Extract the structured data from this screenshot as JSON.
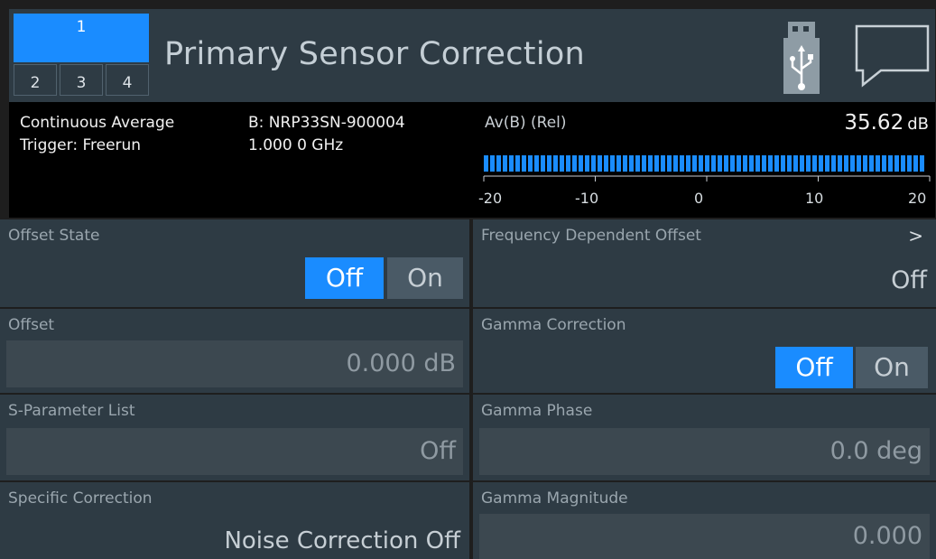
{
  "header": {
    "active_tab": "1",
    "tabs": [
      "2",
      "3",
      "4"
    ],
    "title": "Primary Sensor Correction",
    "usb_icon": "usb-icon",
    "message_icon": "message-icon"
  },
  "status": {
    "mode": "Continuous Average",
    "trigger": "Trigger: Freerun",
    "sensor": "B: NRP33SN-900004",
    "frequency": "1.000 0 GHz",
    "reading_label": "Av(B) (Rel)",
    "reading_value": "35.62",
    "reading_unit": "dB",
    "bar_range": [
      -20,
      20
    ],
    "bar_level": 35.62,
    "tick_labels": [
      "-20",
      "-10",
      "0",
      "10",
      "20"
    ],
    "accent": "#1a8cff"
  },
  "params": {
    "offset_state": {
      "label": "Offset State",
      "off": "Off",
      "on": "On",
      "selected": "Off"
    },
    "freq_dep_offset": {
      "label": "Frequency Dependent Offset",
      "value": "Off",
      "chevron": ">"
    },
    "offset": {
      "label": "Offset",
      "value": "0.000  dB"
    },
    "gamma_correction": {
      "label": "Gamma Correction",
      "off": "Off",
      "on": "On",
      "selected": "Off"
    },
    "s_param_list": {
      "label": "S-Parameter List",
      "value": "Off"
    },
    "gamma_phase": {
      "label": "Gamma Phase",
      "value": "0.0  deg"
    },
    "specific_correction": {
      "label": "Specific Correction",
      "value": "Noise Correction Off"
    },
    "gamma_magnitude": {
      "label": "Gamma Magnitude",
      "value": "0.000"
    }
  }
}
